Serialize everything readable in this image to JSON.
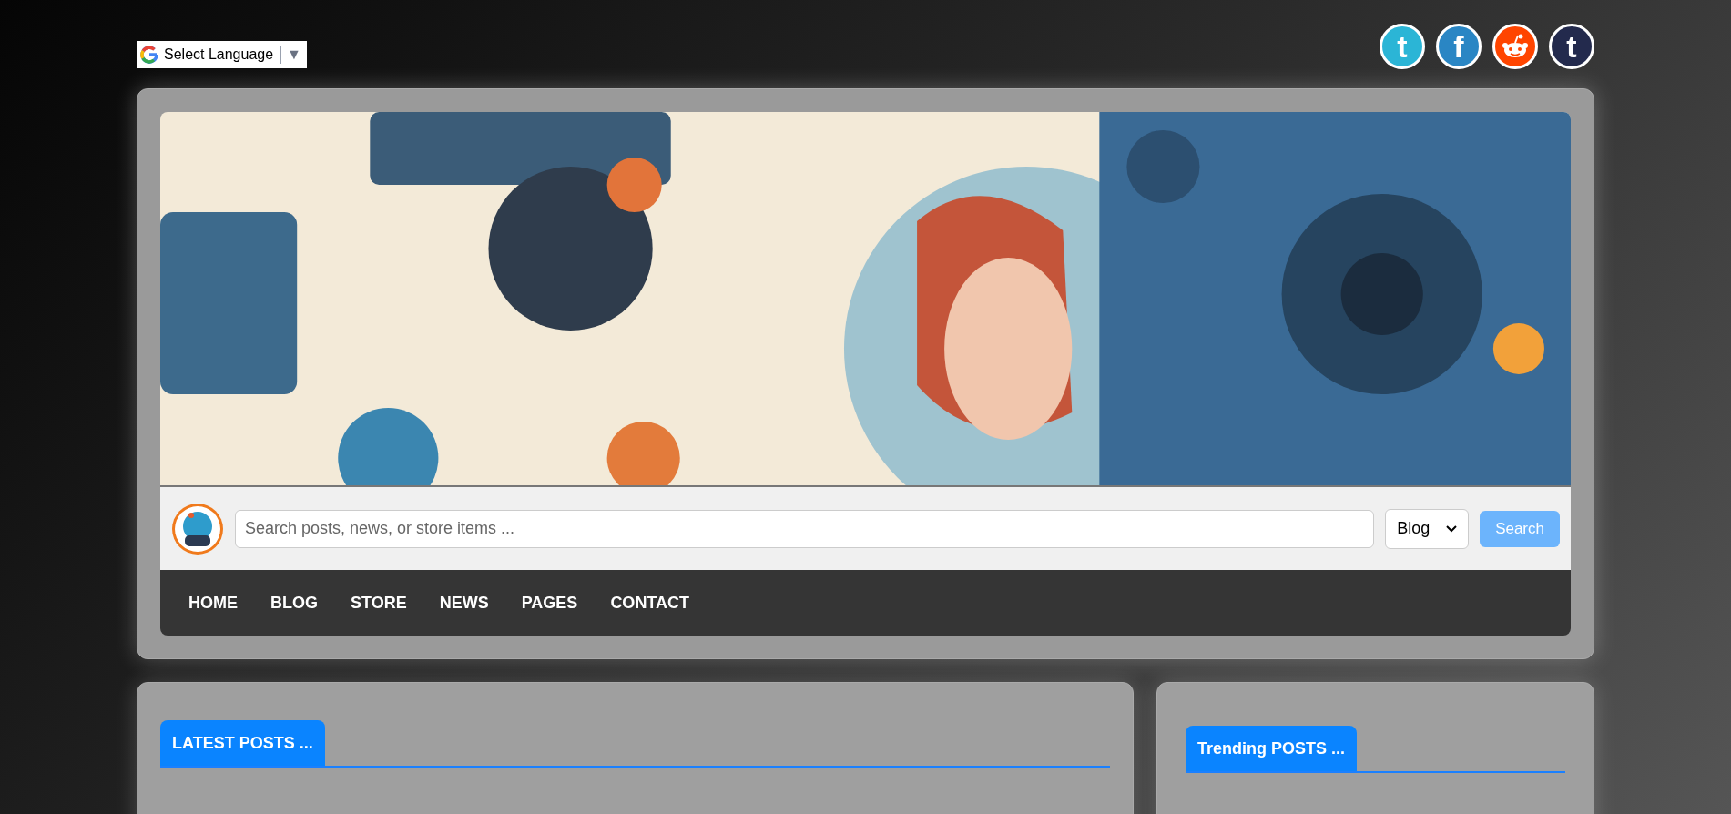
{
  "language_selector": {
    "label": "Select Language",
    "arrow": "▼"
  },
  "social_links": [
    {
      "kind": "letter",
      "glyph": "t",
      "color": "#2bb5d6"
    },
    {
      "kind": "letter",
      "glyph": "f",
      "color": "#2a86c4"
    },
    {
      "kind": "reddit",
      "color": "#ff4500"
    },
    {
      "kind": "letter",
      "glyph": "t",
      "color": "#232a4d"
    }
  ],
  "search": {
    "placeholder": "Search posts, news, or store items ...",
    "category": "Blog",
    "button": "Search"
  },
  "nav": [
    {
      "label": "HOME"
    },
    {
      "label": "BLOG"
    },
    {
      "label": "STORE"
    },
    {
      "label": "NEWS"
    },
    {
      "label": "PAGES"
    },
    {
      "label": "CONTACT"
    }
  ],
  "sections": [
    {
      "title": "LATEST POSTS ..."
    },
    {
      "title": "Trending POSTS ..."
    }
  ]
}
